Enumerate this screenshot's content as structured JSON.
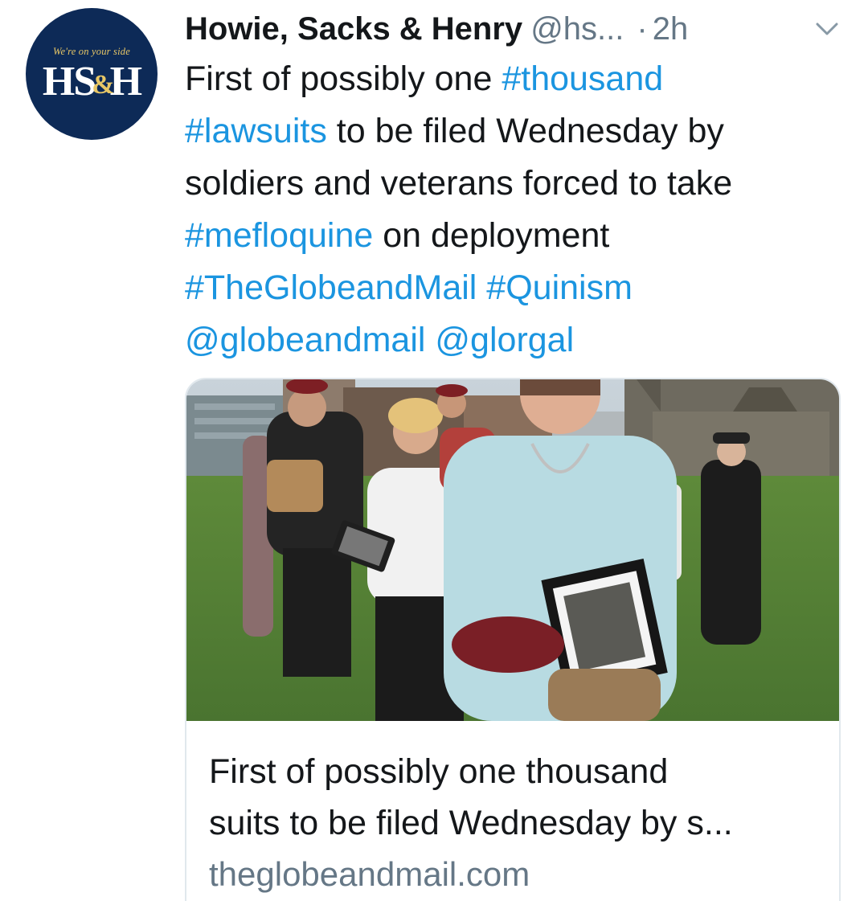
{
  "author": {
    "avatar": {
      "slogan": "We're on your side",
      "monogram_left": "HS",
      "monogram_amp": "&",
      "monogram_right": "H"
    },
    "name": "Howie, Sacks & Henry",
    "handle": "@hs...",
    "separator": "·",
    "time": "2h"
  },
  "menu": {
    "icon": "chevron-down-icon"
  },
  "tweet": {
    "lines": [
      [
        {
          "t": "First of possibly one ",
          "link": false
        },
        {
          "t": "#thousand",
          "link": true
        }
      ],
      [
        {
          "t": "#lawsuits",
          "link": true
        },
        {
          "t": " to be filed Wednesday by",
          "link": false
        }
      ],
      [
        {
          "t": "soldiers and veterans forced to take",
          "link": false
        }
      ],
      [
        {
          "t": "#mefloquine",
          "link": true
        },
        {
          "t": " on deployment",
          "link": false
        }
      ],
      [
        {
          "t": "#TheGlobeandMail",
          "link": true
        },
        {
          "t": " ",
          "link": false
        },
        {
          "t": "#Quinism",
          "link": true
        }
      ],
      [
        {
          "t": "@globeandmail",
          "link": true
        },
        {
          "t": " ",
          "link": false
        },
        {
          "t": "@glorgal",
          "link": true
        }
      ]
    ]
  },
  "card": {
    "title_line1": "First of possibly one thousand",
    "title_line2": "suits to be filed Wednesday by s...",
    "domain": "theglobeandmail.com"
  },
  "colors": {
    "link": "#1b95e0",
    "text": "#14171a",
    "secondary": "#657786",
    "avatar_bg": "#0d2a57",
    "avatar_gold": "#e8c766"
  }
}
